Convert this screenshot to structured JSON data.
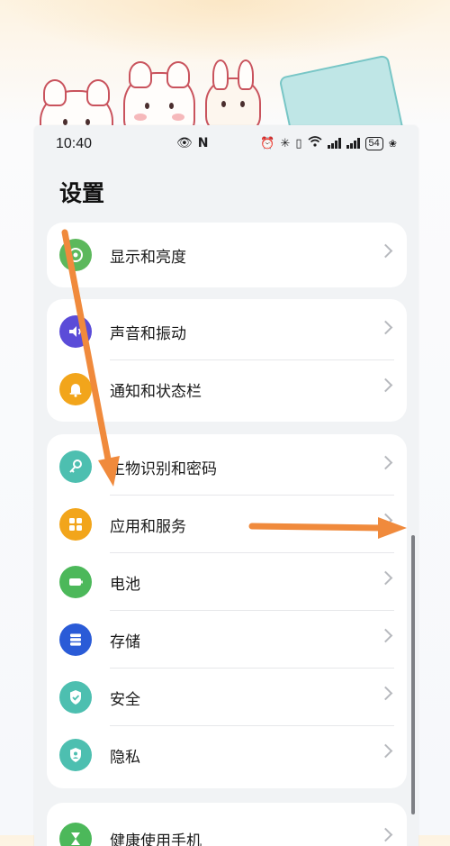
{
  "status_bar": {
    "time": "10:40",
    "battery": "54",
    "icons": [
      "eye-icon",
      "nfc-icon",
      "alarm-icon",
      "bluetooth-icon",
      "vibrate-icon",
      "wifi-icon",
      "signal-icon",
      "signal-icon",
      "battery-icon",
      "charging-leaf-icon"
    ]
  },
  "page": {
    "title": "设置"
  },
  "groups": [
    {
      "items": [
        {
          "label": "显示和亮度",
          "icon": "eye-display-icon",
          "color": "#5cb85c"
        }
      ]
    },
    {
      "items": [
        {
          "label": "声音和振动",
          "icon": "speaker-icon",
          "color": "#5b4cd8"
        },
        {
          "label": "通知和状态栏",
          "icon": "bell-icon",
          "color": "#f2a51b"
        }
      ]
    },
    {
      "items": [
        {
          "label": "生物识别和密码",
          "icon": "key-icon",
          "color": "#4dbfb0"
        },
        {
          "label": "应用和服务",
          "icon": "apps-grid-icon",
          "color": "#f2a51b"
        },
        {
          "label": "电池",
          "icon": "battery-icon",
          "color": "#4cb85a"
        },
        {
          "label": "存储",
          "icon": "storage-icon",
          "color": "#2a5bd7"
        },
        {
          "label": "安全",
          "icon": "shield-icon",
          "color": "#4dbfb0"
        },
        {
          "label": "隐私",
          "icon": "privacy-icon",
          "color": "#4dbfb0"
        }
      ]
    },
    {
      "items": [
        {
          "label": "健康使用手机",
          "icon": "hourglass-icon",
          "color": "#4cb85a"
        }
      ]
    }
  ],
  "annotation_color": "#f08a3c"
}
